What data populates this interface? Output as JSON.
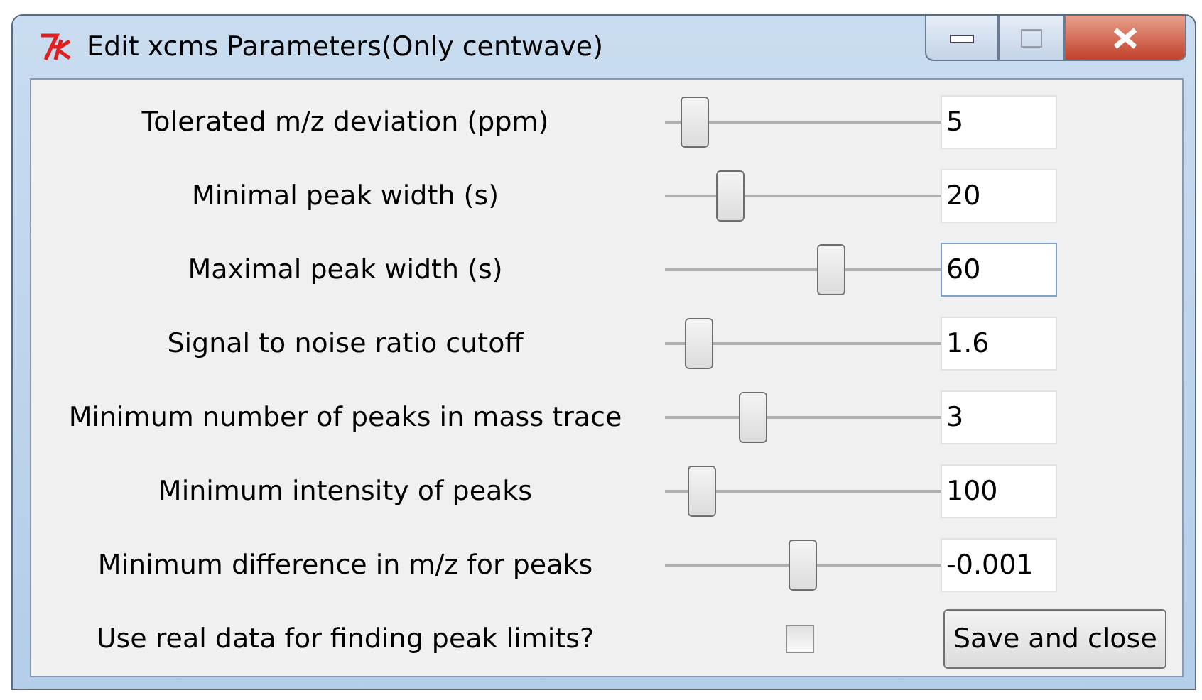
{
  "window": {
    "title": "Edit xcms Parameters(Only centwave)"
  },
  "parameters": [
    {
      "label": "Tolerated m/z deviation (ppm)",
      "level": 0.06,
      "value": "5",
      "focused": false
    },
    {
      "label": "Minimal peak width (s)",
      "level": 0.2,
      "value": "20",
      "focused": false
    },
    {
      "label": "Maximal peak width (s)",
      "level": 0.6,
      "value": "60",
      "focused": true
    },
    {
      "label": "Signal to noise ratio cutoff",
      "level": 0.08,
      "value": "1.6",
      "focused": false
    },
    {
      "label": "Minimum number of peaks in mass trace",
      "level": 0.29,
      "value": "3",
      "focused": false
    },
    {
      "label": "Minimum intensity of peaks",
      "level": 0.09,
      "value": "100",
      "focused": false
    },
    {
      "label": "Minimum difference in m/z for peaks",
      "level": 0.49,
      "value": "-0.001",
      "focused": false
    }
  ],
  "option": {
    "label": "Use real data for finding peak limits?",
    "checked": false
  },
  "buttons": [
    "Save and close"
  ]
}
